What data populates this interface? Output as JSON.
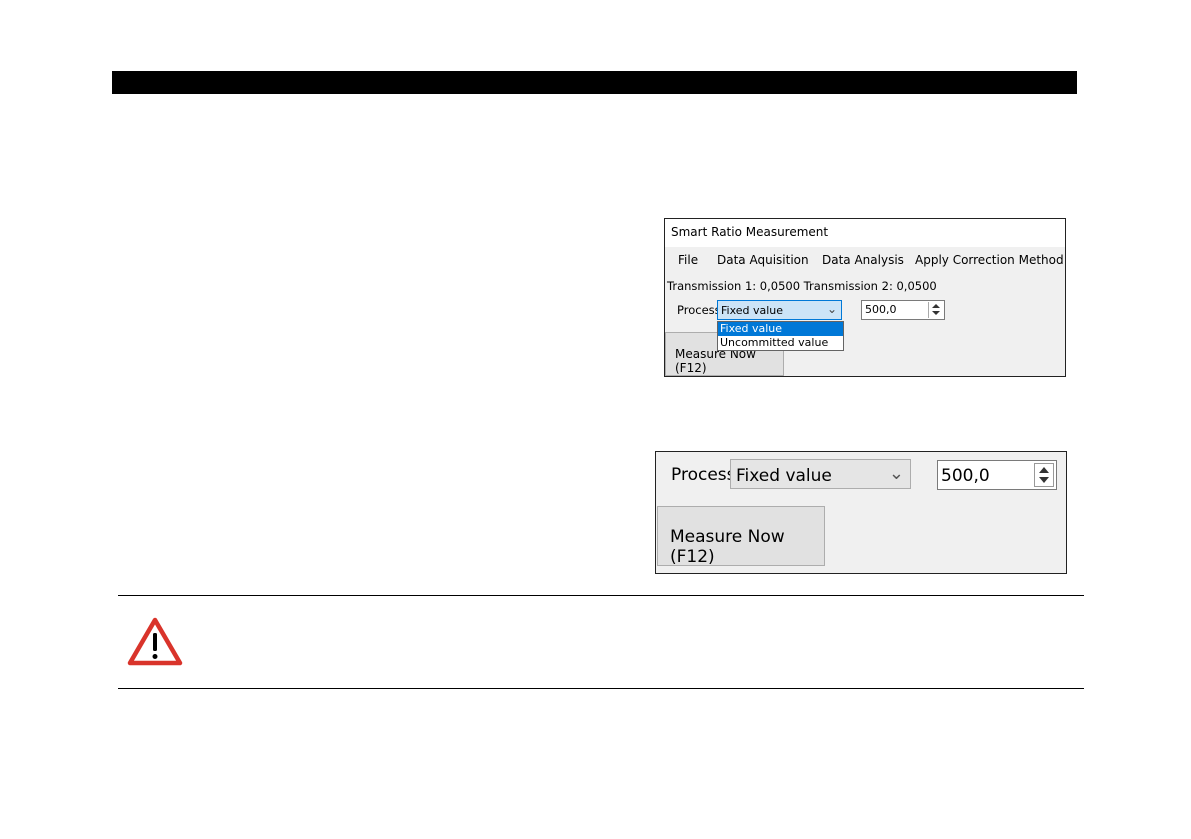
{
  "window": {
    "title": "Smart Ratio Measurement",
    "menu": [
      "File",
      "Data Aquisition",
      "Data Analysis",
      "Apply Correction Method"
    ],
    "transmission_text": "Transmission 1: 0,0500  Transmission 2: 0,0500",
    "process_label": "Process",
    "process_selected": "Fixed value",
    "process_options": [
      "Fixed value",
      "Uncommitted value"
    ],
    "stepper_value": "500,0",
    "measure_button": "Measure Now (F12)"
  },
  "zoomed": {
    "process_label": "Process",
    "process_selected": "Fixed value",
    "stepper_value": "500,0",
    "measure_button": "Measure Now (F12)"
  },
  "colors": {
    "accent": "#0078d7",
    "warning_red": "#d9342b"
  }
}
